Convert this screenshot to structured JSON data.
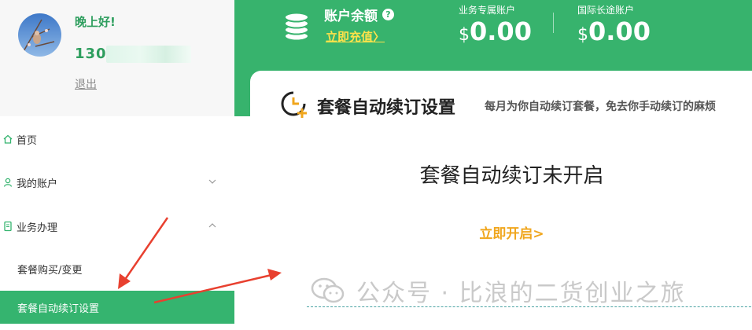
{
  "profile": {
    "greeting": "晚上好!",
    "phone": "130",
    "logout": "退出"
  },
  "nav": {
    "home": "首页",
    "my_account": "我的账户",
    "business": "业务办理",
    "sub_items": [
      "套餐购买/变更",
      "套餐自动续订设置"
    ],
    "active_item": "套餐自动续订设置"
  },
  "header": {
    "balance_title": "账户余额",
    "recharge": "立即充值",
    "recharge_arrow": "〉",
    "accounts": [
      {
        "label": "业务专属账户",
        "currency": "$",
        "amount": "0.00"
      },
      {
        "label": "国际长途账户",
        "currency": "$",
        "amount": "0.00"
      }
    ]
  },
  "card": {
    "title": "套餐自动续订设置",
    "subtitle": "每月为你自动续订套餐，免去你手动续订的麻烦",
    "status": "套餐自动续订未开启",
    "enable": "立即开启>"
  },
  "watermark": {
    "text": "公众号 · 比浪的二货创业之旅"
  },
  "colors": {
    "brand_green": "#37b36d",
    "accent_yellow": "#ffe24a",
    "action_orange": "#f0a61d",
    "annotation_red": "#e8402f"
  }
}
